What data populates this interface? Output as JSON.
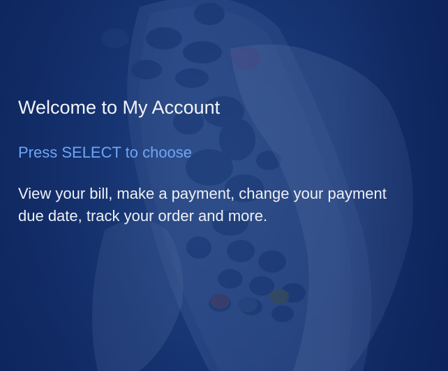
{
  "screen": {
    "title": "Welcome to My Account",
    "hint": "Press SELECT to choose",
    "description": "View your bill, make a payment, change your payment due date, track your order and more."
  },
  "background": {
    "image": "hand-holding-remote",
    "remote_logo": "sky"
  },
  "colors": {
    "background": "#13306d",
    "title": "#f2f4f8",
    "hint": "#6fa6f5",
    "description": "#eef1f6"
  }
}
